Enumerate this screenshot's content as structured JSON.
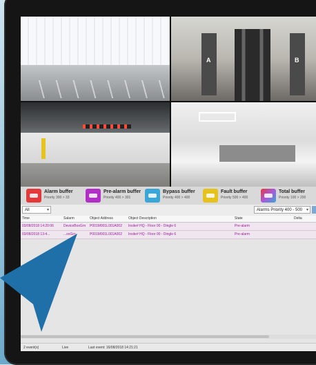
{
  "buffers": [
    {
      "title": "Alarm buffer",
      "subtitle": "Priority 300 > 33",
      "color": "#e23a3a"
    },
    {
      "title": "Pre-alarm buffer",
      "subtitle": "Priority 400 > 301",
      "color": "#b12fc7"
    },
    {
      "title": "Bypass buffer",
      "subtitle": "Priority 400 > 400",
      "color": "#3aa6d8"
    },
    {
      "title": "Fault buffer",
      "subtitle": "Priority 500 > 400",
      "color": "#e6c21d"
    },
    {
      "title": "Total buffer",
      "subtitle": "Priority 100 > 200",
      "color": "#a85ad8"
    }
  ],
  "filter": {
    "left_value": "All",
    "right_value": "Alarms Priority 400 - 500"
  },
  "table": {
    "columns": [
      "Time",
      "Salarm",
      "Object Address",
      "Object Description",
      "State",
      "Delta"
    ],
    "rows": [
      [
        "03/08/2018 14:20:06",
        "DeviceBoxGrn",
        "P001M001L001A002",
        "Insite# HQ - Floor 00 - Dingle 6",
        "Pre-alarm",
        ""
      ],
      [
        "03/08/2018 13:4...",
        "...oxGrn",
        "P001M001L001A002",
        "Insite# HQ - Floor 00 - Dingle 6",
        "Pre-alarm",
        ""
      ]
    ]
  },
  "status": {
    "user": "2 event(s)",
    "mode": "Live",
    "updated": "Last event: 16/08/2018 14:21:21"
  },
  "camera_signs": {
    "left": "A",
    "right": "B"
  }
}
